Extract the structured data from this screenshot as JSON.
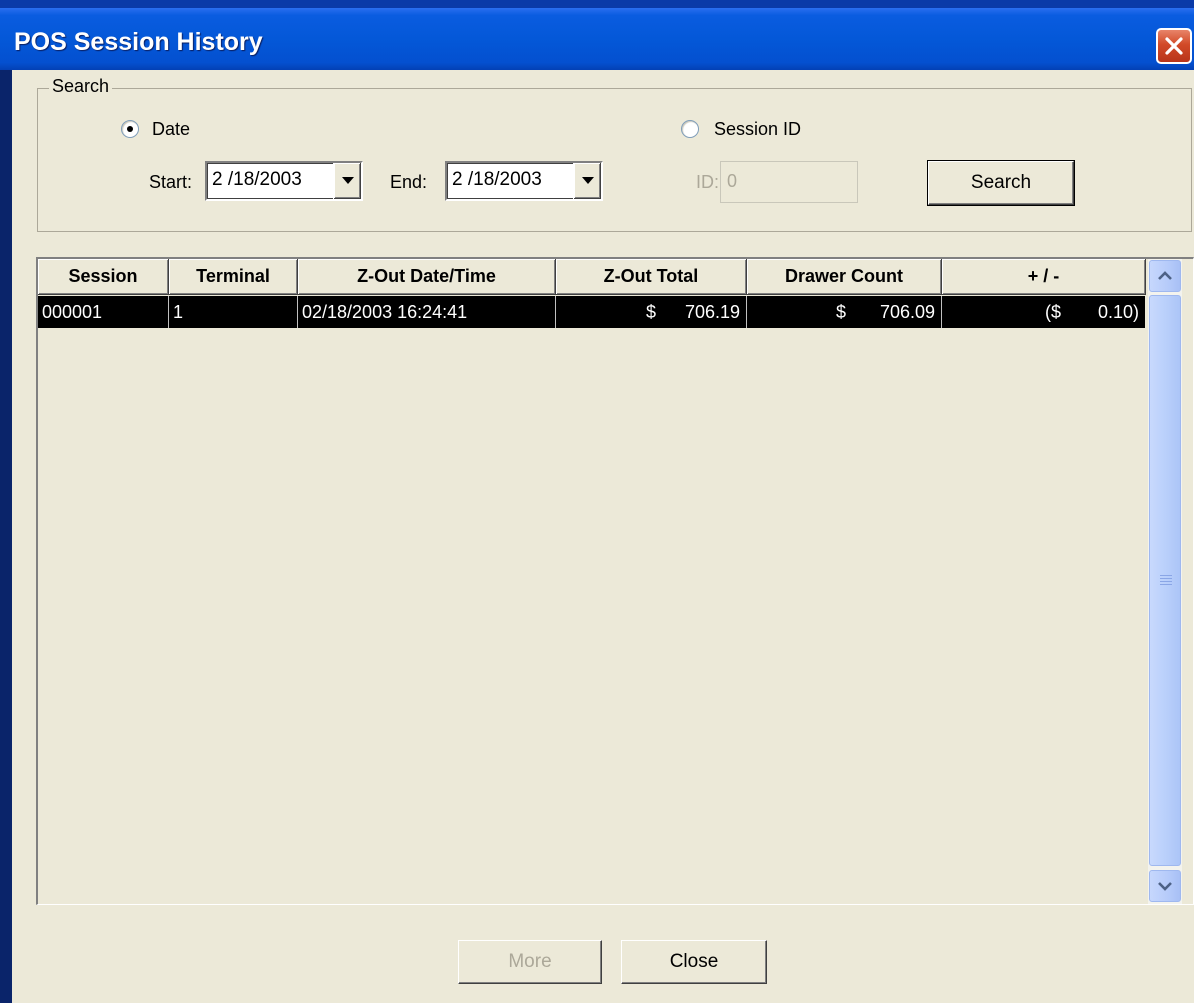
{
  "window": {
    "title": "POS Session History"
  },
  "search": {
    "group_label": "Search",
    "mode_date_label": "Date",
    "mode_session_label": "Session ID",
    "selected_mode": "Date",
    "start_label": "Start:",
    "start_value": "2 /18/2003",
    "end_label": "End:",
    "end_value": "2 /18/2003",
    "id_label": "ID:",
    "id_value": "0",
    "search_button": "Search"
  },
  "grid": {
    "columns": [
      "Session",
      "Terminal",
      "Z-Out Date/Time",
      "Z-Out Total",
      "Drawer Count",
      "+ / -"
    ],
    "rows": [
      {
        "session": "000001",
        "terminal": "1",
        "zout_datetime": "02/18/2003 16:24:41",
        "zout_total_currency": "$",
        "zout_total": "706.19",
        "drawer_count_currency": "$",
        "drawer_count": "706.09",
        "diff_currency": "($",
        "diff": "0.10)"
      }
    ],
    "selected_row": 0
  },
  "footer": {
    "more_button": "More",
    "close_button": "Close"
  },
  "colors": {
    "title_bar": "#0458D8",
    "dialog_face": "#ECE9D8",
    "selected_row": "#000000",
    "close_button": "#D24A28"
  },
  "icons": {
    "close": "close-x-icon",
    "combo_arrow": "chevron-down-icon",
    "scroll_up": "chevron-up-icon",
    "scroll_down": "chevron-down-icon"
  }
}
